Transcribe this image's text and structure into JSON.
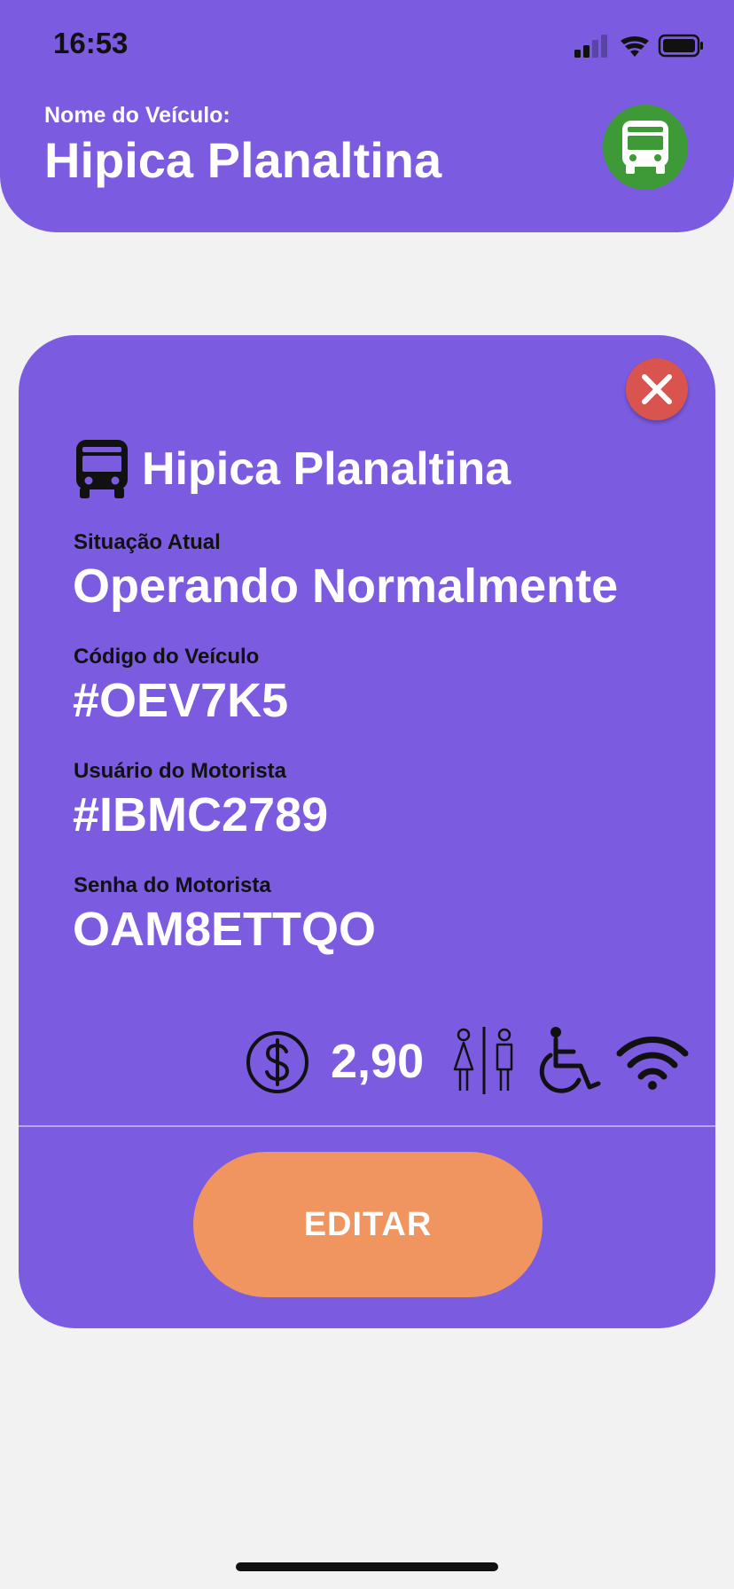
{
  "status_bar": {
    "time": "16:53"
  },
  "header": {
    "label": "Nome do Veículo:",
    "title": "Hipica Planaltina",
    "avatar_icon": "bus-icon",
    "avatar_color": "#3d9a36"
  },
  "card": {
    "title": "Hipica Planaltina",
    "title_icon": "bus-icon",
    "close_icon": "close-icon",
    "fields": [
      {
        "label": "Situação Atual",
        "value": "Operando Normalmente"
      },
      {
        "label": "Código do Veículo",
        "value": "#OEV7K5"
      },
      {
        "label": "Usuário do Motorista",
        "value": "#IBMC2789"
      },
      {
        "label": "Senha do Motorista",
        "value": "OAM8ETTQO"
      }
    ],
    "amenities": {
      "price": "2,90",
      "icons": [
        "dollar-icon",
        "restroom-icon",
        "wheelchair-icon",
        "wifi-icon"
      ]
    },
    "edit_button": "EDITAR"
  },
  "colors": {
    "primary": "#7b5be0",
    "close": "#d9534f",
    "edit": "#f0955f",
    "background": "#f2f2f2"
  }
}
